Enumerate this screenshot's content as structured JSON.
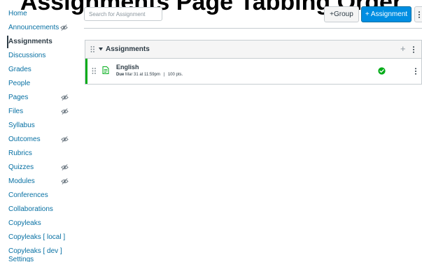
{
  "banner": {
    "text": "Assignments Page Tabbing Order"
  },
  "sidebar": {
    "items": [
      {
        "label": "Home",
        "hidden": false,
        "active": false
      },
      {
        "label": "Announcements",
        "hidden": true,
        "active": false
      },
      {
        "label": "Assignments",
        "hidden": false,
        "active": true
      },
      {
        "label": "Discussions",
        "hidden": false,
        "active": false
      },
      {
        "label": "Grades",
        "hidden": false,
        "active": false
      },
      {
        "label": "People",
        "hidden": false,
        "active": false
      },
      {
        "label": "Pages",
        "hidden": true,
        "active": false
      },
      {
        "label": "Files",
        "hidden": true,
        "active": false
      },
      {
        "label": "Syllabus",
        "hidden": false,
        "active": false
      },
      {
        "label": "Outcomes",
        "hidden": true,
        "active": false
      },
      {
        "label": "Rubrics",
        "hidden": false,
        "active": false
      },
      {
        "label": "Quizzes",
        "hidden": true,
        "active": false
      },
      {
        "label": "Modules",
        "hidden": true,
        "active": false
      },
      {
        "label": "Conferences",
        "hidden": false,
        "active": false
      },
      {
        "label": "Collaborations",
        "hidden": false,
        "active": false
      },
      {
        "label": "Copyleaks",
        "hidden": false,
        "active": false
      },
      {
        "label": "Copyleaks [ local ]",
        "hidden": false,
        "active": false
      },
      {
        "label": "Copyleaks [ dev ]",
        "hidden": false,
        "active": false
      },
      {
        "label": "Settings",
        "hidden": false,
        "active": false
      }
    ]
  },
  "toolbar": {
    "search_placeholder": "Search for Assignment",
    "group_button": "+Group",
    "assignment_button": "+ Assignment"
  },
  "group": {
    "title": "Assignments",
    "add_symbol": "+",
    "assignments": [
      {
        "title": "English",
        "due_label": "Due",
        "due_date": "Mar 31 at 11:59pm",
        "separator": "|",
        "points": "100 pts.",
        "published": true
      }
    ]
  },
  "icons": {
    "hidden": "eye-slash-icon",
    "drag": "drag-handle-icon",
    "caret": "caret-down-icon",
    "assignment": "assignment-doc-icon",
    "published": "published-check-icon",
    "kebab": "kebab-menu-icon"
  },
  "colors": {
    "link": "#0770a3",
    "text": "#2d3b45",
    "primary_button": "#008ee2",
    "published_green": "#00ac18",
    "border": "#c7cdd1",
    "header_bg": "#f5f5f5"
  }
}
